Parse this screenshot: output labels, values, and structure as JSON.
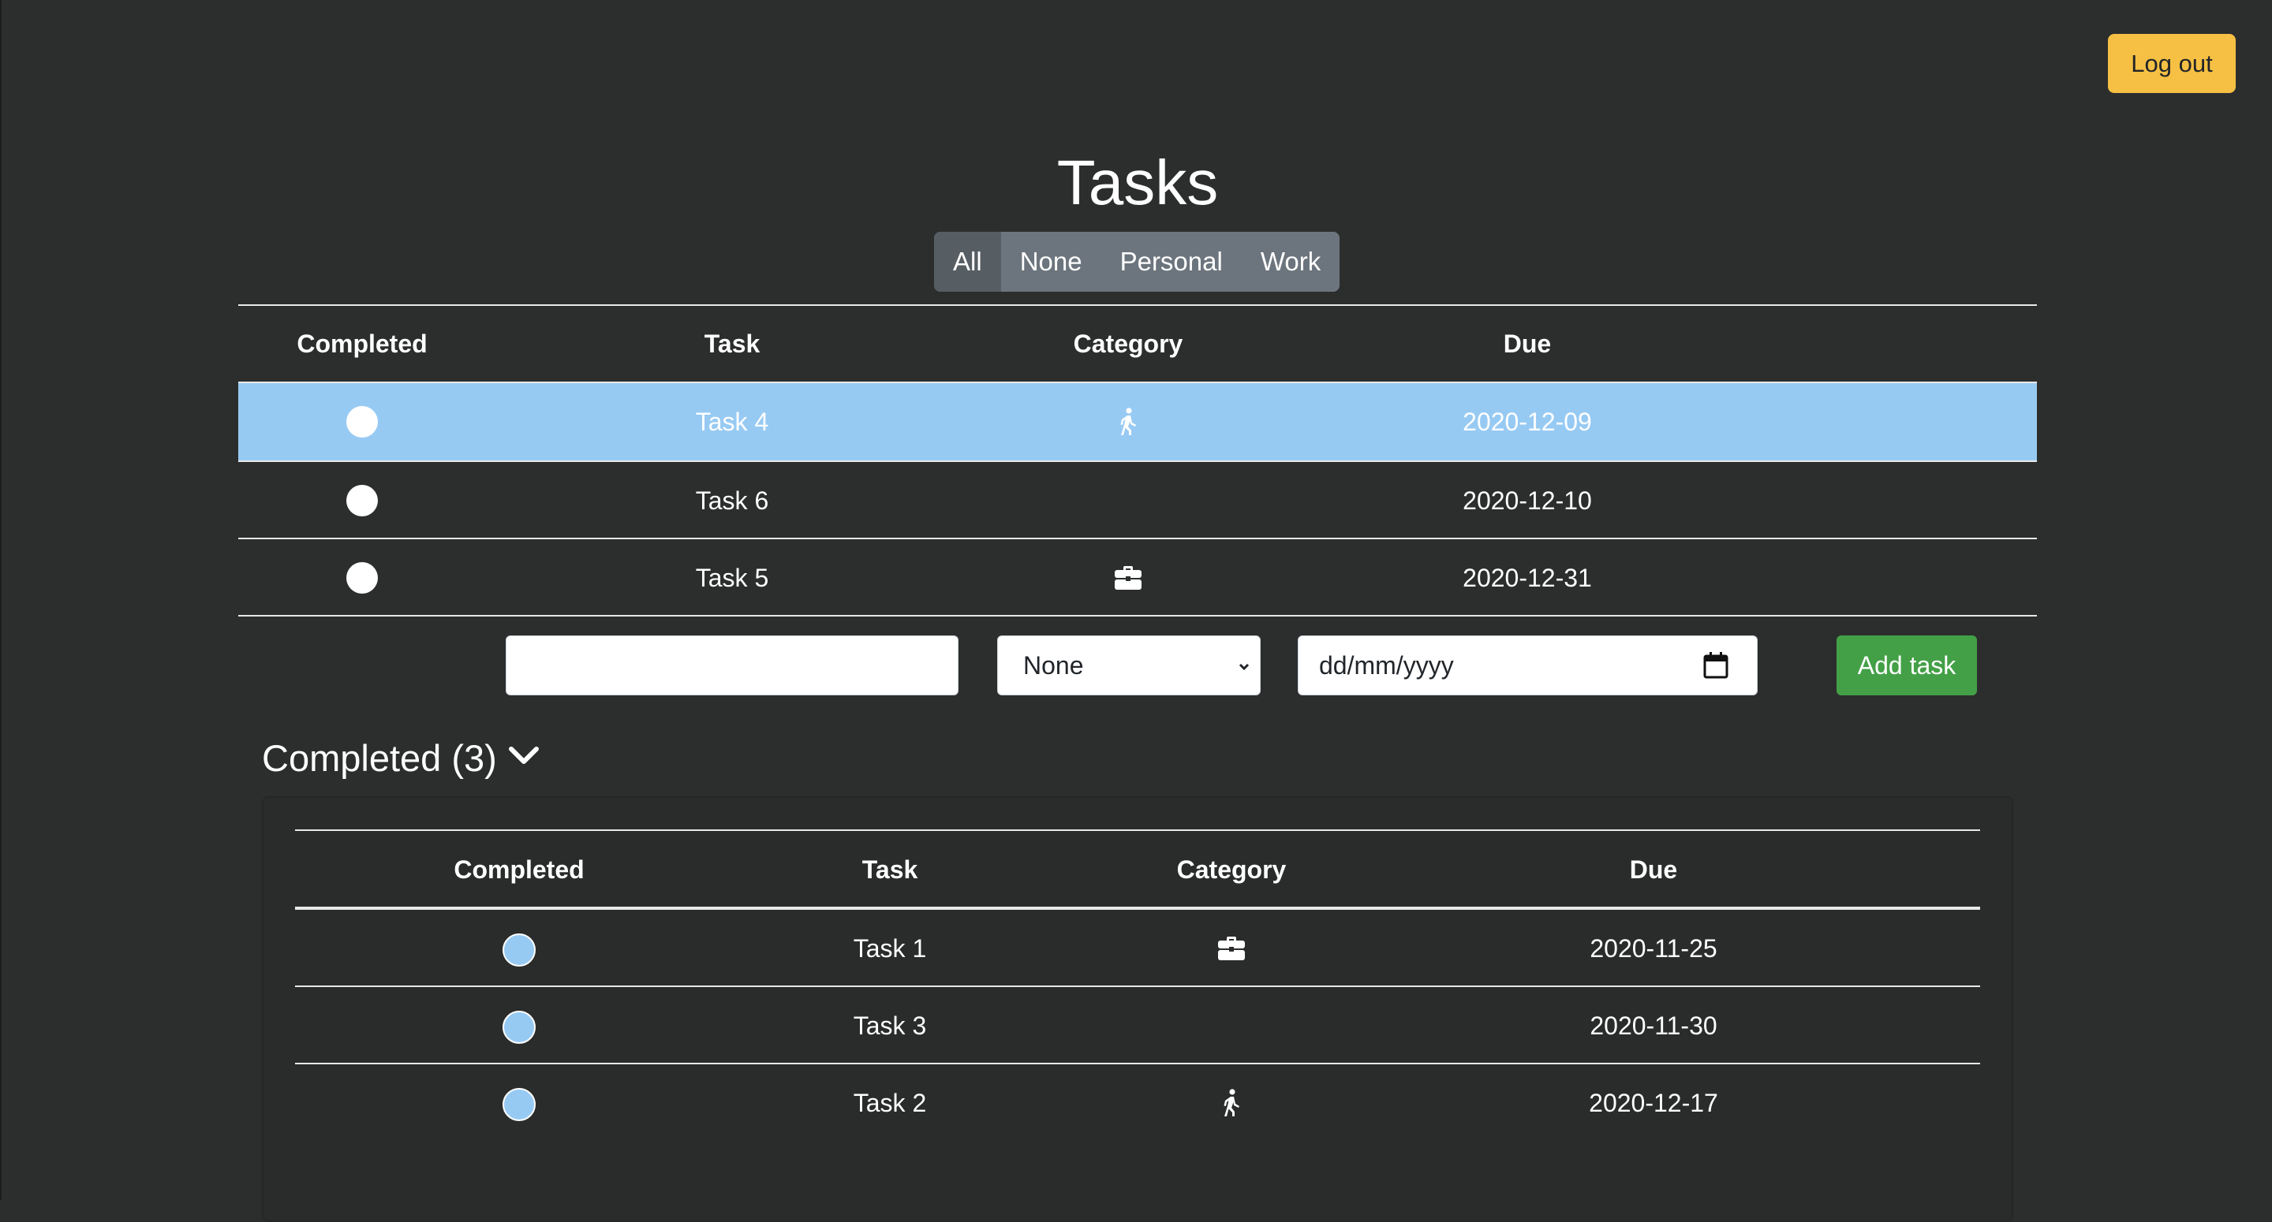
{
  "header": {
    "logout_label": "Log out",
    "title": "Tasks"
  },
  "filters": [
    {
      "label": "All",
      "active": true
    },
    {
      "label": "None",
      "active": false
    },
    {
      "label": "Personal",
      "active": false
    },
    {
      "label": "Work",
      "active": false
    }
  ],
  "tasks_table": {
    "columns": [
      "Completed",
      "Task",
      "Category",
      "Due"
    ],
    "rows": [
      {
        "task": "Task 4",
        "category_icon": "walking-icon",
        "due": "2020-12-09",
        "completed": false,
        "highlighted": true
      },
      {
        "task": "Task 6",
        "category_icon": "",
        "due": "2020-12-10",
        "completed": false,
        "highlighted": false
      },
      {
        "task": "Task 5",
        "category_icon": "briefcase-icon",
        "due": "2020-12-31",
        "completed": false,
        "highlighted": false
      }
    ]
  },
  "new_task_form": {
    "task_value": "",
    "category_selected": "None",
    "due_placeholder": "dd/mm/yyyy",
    "add_label": "Add task"
  },
  "completed_section": {
    "heading": "Completed (3)",
    "columns": [
      "Completed",
      "Task",
      "Category",
      "Due"
    ],
    "rows": [
      {
        "task": "Task 1",
        "category_icon": "briefcase-icon",
        "due": "2020-11-25",
        "completed": true
      },
      {
        "task": "Task 3",
        "category_icon": "",
        "due": "2020-11-30",
        "completed": true
      },
      {
        "task": "Task 2",
        "category_icon": "walking-icon",
        "due": "2020-12-17",
        "completed": true
      }
    ]
  },
  "colors": {
    "background": "#2c2e2e",
    "highlight_row": "#97caf3",
    "logout_button": "#f5c043",
    "add_button": "#43a047",
    "filter_group": "#6c757d",
    "filter_active": "#565e64"
  }
}
